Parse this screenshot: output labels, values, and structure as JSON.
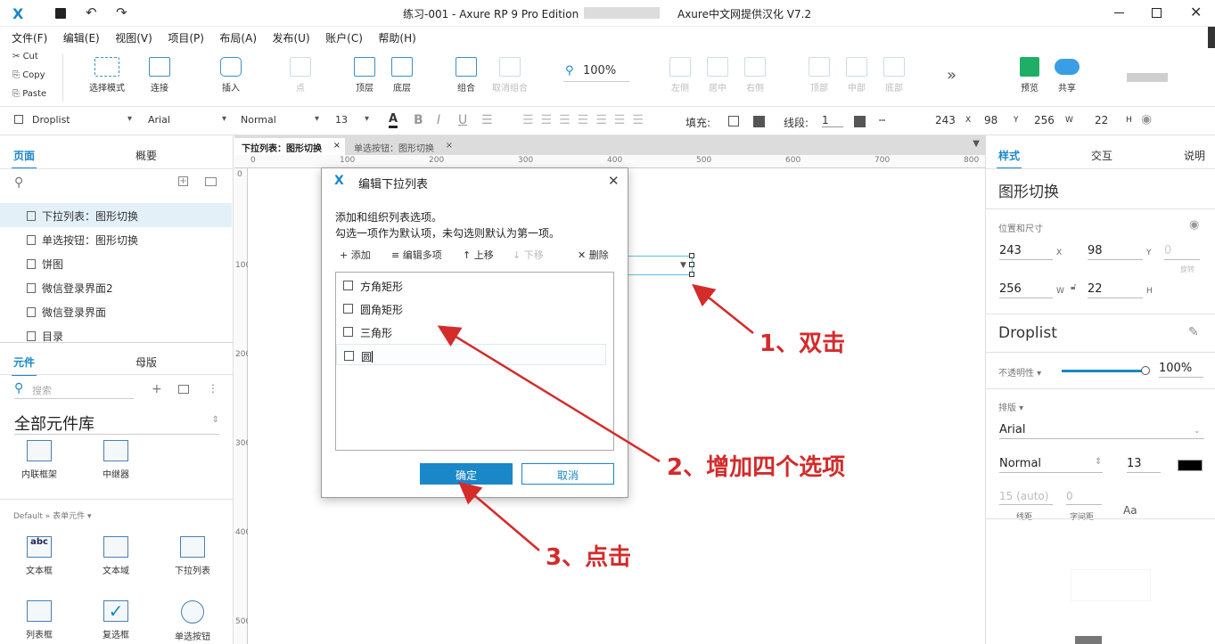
{
  "window": {
    "title": "练习-001 - Axure RP 9 Pro Edition",
    "subtitle": "Axure中文网提供汉化 V7.2"
  },
  "menu": [
    "文件(F)",
    "编辑(E)",
    "视图(V)",
    "项目(P)",
    "布局(A)",
    "发布(U)",
    "账户(C)",
    "帮助(H)"
  ],
  "clipboard": {
    "cut": "Cut",
    "copy": "Copy",
    "paste": "Paste"
  },
  "toolbar": {
    "select_mode": "选择模式",
    "connect": "连接",
    "insert": "插入",
    "point": "点",
    "top": "顶层",
    "bottom": "底层",
    "group": "组合",
    "ungroup": "取消组合",
    "zoom": "100%",
    "align_left": "左侧",
    "align_center": "居中",
    "align_right": "右侧",
    "align_top": "顶部",
    "align_middle": "中部",
    "align_bottom": "底部",
    "more": "»",
    "preview": "预览",
    "share": "共享"
  },
  "format": {
    "widget_type": "Droplist",
    "font": "Arial",
    "weight": "Normal",
    "size": "13",
    "fill_label": "填充:",
    "stroke_label": "线段:",
    "stroke_width": "1",
    "x": "243",
    "y": "98",
    "w": "256",
    "h": "22"
  },
  "left": {
    "tab_pages": "页面",
    "tab_outline": "概要",
    "pages": [
      "下拉列表：图形切换",
      "单选按钮：图形切换",
      "饼图",
      "微信登录界面2",
      "微信登录界面",
      "目录"
    ],
    "tab_widgets": "元件",
    "tab_masters": "母版",
    "search_placeholder": "搜索",
    "library": "全部元件库",
    "widgets_top": [
      "内联框架",
      "中继器"
    ],
    "category": "Default » 表单元件 ▾",
    "form_widgets": [
      "文本框",
      "文本域",
      "下拉列表",
      "列表框",
      "复选框",
      "单选按钮"
    ]
  },
  "canvas": {
    "tabs": [
      "下拉列表：图形切换",
      "单选按钮：图形切换"
    ],
    "ruler_h": [
      "0",
      "100",
      "200",
      "300",
      "400",
      "500",
      "600",
      "700",
      "800"
    ],
    "ruler_v": [
      "0",
      "100",
      "200",
      "300",
      "400",
      "500"
    ]
  },
  "right": {
    "tab_style": "样式",
    "tab_interact": "交互",
    "tab_notes": "说明",
    "page_name": "图形切换",
    "pos_size_label": "位置和尺寸",
    "x": "243",
    "y": "98",
    "rot": "0",
    "rot_label": "旋转",
    "w": "256",
    "h": "22",
    "widget_name": "Droplist",
    "opacity_label": "不透明性 ▾",
    "opacity": "100%",
    "typography_label": "排版 ▾",
    "font": "Arial",
    "weight": "Normal",
    "size": "13",
    "line_height": "15 (auto)",
    "letter_spacing": "0",
    "line_height_label": "线距",
    "letter_spacing_label": "字间距"
  },
  "dialog": {
    "title": "编辑下拉列表",
    "desc1": "添加和组织列表选项。",
    "desc2": "勾选一项作为默认项，未勾选则默认为第一项。",
    "add": "+ 添加",
    "edit_multi": "≡ 编辑多项",
    "move_up": "↑ 上移",
    "move_down": "↓ 下移",
    "delete": "✕ 删除",
    "options": [
      "方角矩形",
      "圆角矩形",
      "三角形",
      "圆"
    ],
    "ok": "确定",
    "cancel": "取消"
  },
  "annotations": {
    "step1": "1、双击",
    "step2": "2、增加四个选项",
    "step3": "3、点击"
  },
  "colors": {
    "accent": "#1a87c9",
    "annotation": "#d42b2b"
  }
}
